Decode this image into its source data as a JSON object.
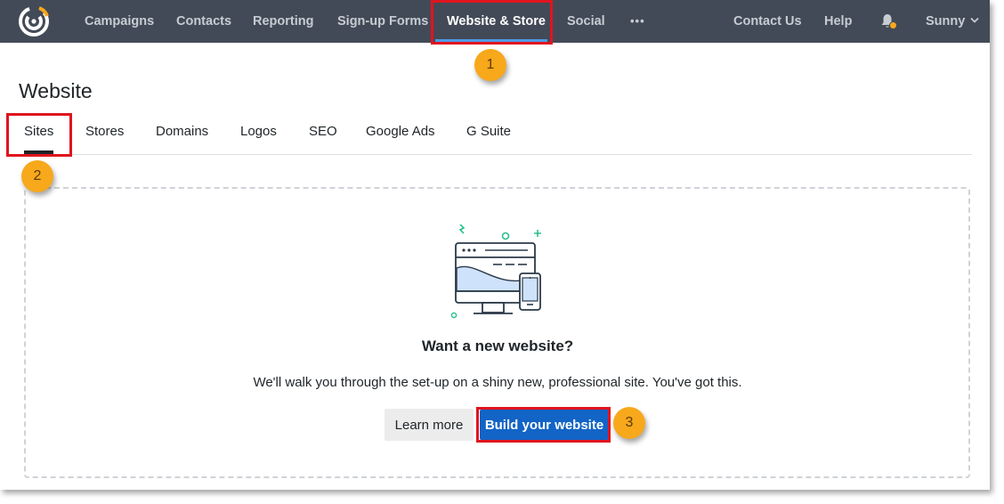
{
  "nav": {
    "logo_icon": "constant-contact-logo-icon",
    "items": [
      {
        "label": "Campaigns"
      },
      {
        "label": "Contacts"
      },
      {
        "label": "Reporting"
      },
      {
        "label": "Sign-up Forms"
      },
      {
        "label": "Website & Store"
      },
      {
        "label": "Social"
      }
    ],
    "more_label": "•••",
    "contact_label": "Contact Us",
    "help_label": "Help",
    "bell_icon": "bell-icon",
    "user_label": "Sunny",
    "user_chevron": "˅",
    "colors": {
      "bar": "#434a57",
      "active_underline": "#4c9be8",
      "notification_dot": "#f7a81b"
    }
  },
  "annotations": {
    "bubble1": "1",
    "bubble2": "2",
    "bubble3": "3",
    "highlight_color": "#e0141e",
    "bubble_color": "#f7a81b"
  },
  "page": {
    "title": "Website",
    "tabs": [
      {
        "label": "Sites"
      },
      {
        "label": "Stores"
      },
      {
        "label": "Domains"
      },
      {
        "label": "Logos"
      },
      {
        "label": "SEO"
      },
      {
        "label": "Google Ads"
      },
      {
        "label": "G Suite"
      }
    ],
    "active_tab": "Sites"
  },
  "empty_state": {
    "illustration_icon": "website-devices-icon",
    "title": "Want a new website?",
    "description": "We'll walk you through the set-up on a shiny new, professional site. You've got this.",
    "learn_more_label": "Learn more",
    "build_label": "Build your website",
    "primary_color": "#1264c6"
  }
}
